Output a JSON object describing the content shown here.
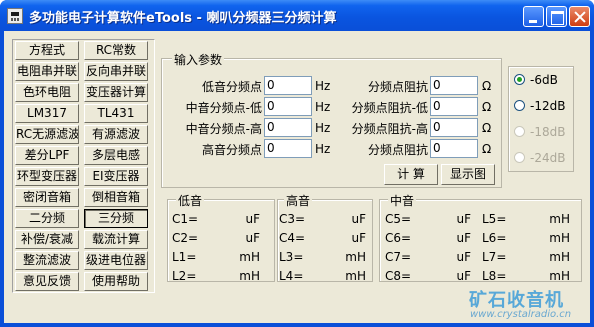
{
  "window": {
    "title": "多功能电子计算软件eTools - 喇叭分频器三分频计算"
  },
  "sidebar": {
    "buttons": [
      "方程式",
      "RC常数",
      "电阻串并联",
      "反向串并联",
      "色环电阻",
      "变压器计算",
      "LM317",
      "TL431",
      "RC无源滤波",
      "有源滤波",
      "差分LPF",
      "多层电感",
      "环型变压器",
      "EI变压器",
      "密闭音箱",
      "倒相音箱",
      "二分频",
      "三分频",
      "补偿/衰减",
      "载流计算",
      "整流滤波",
      "级进电位器",
      "意见反馈",
      "使用帮助"
    ],
    "active_index": 17
  },
  "input_group": {
    "label": "输入参数",
    "rows": [
      {
        "freq_label": "低音分频点",
        "freq_value": "0",
        "freq_unit": "Hz",
        "imp_label": "分频点阻抗",
        "imp_value": "0",
        "imp_unit": "Ω"
      },
      {
        "freq_label": "中音分频点-低",
        "freq_value": "0",
        "freq_unit": "Hz",
        "imp_label": "分频点阻抗-低",
        "imp_value": "0",
        "imp_unit": "Ω"
      },
      {
        "freq_label": "中音分频点-高",
        "freq_value": "0",
        "freq_unit": "Hz",
        "imp_label": "分频点阻抗-高",
        "imp_value": "0",
        "imp_unit": "Ω"
      },
      {
        "freq_label": "高音分频点",
        "freq_value": "0",
        "freq_unit": "Hz",
        "imp_label": "分频点阻抗",
        "imp_value": "0",
        "imp_unit": "Ω"
      }
    ],
    "calc_label": "计 算",
    "show_label": "显示图"
  },
  "slope": {
    "options": [
      {
        "label": "-6dB",
        "checked": true,
        "disabled": false
      },
      {
        "label": "-12dB",
        "checked": false,
        "disabled": false
      },
      {
        "label": "-18dB",
        "checked": false,
        "disabled": true
      },
      {
        "label": "-24dB",
        "checked": false,
        "disabled": true
      }
    ]
  },
  "results": {
    "bass": {
      "label": "低音",
      "rows": [
        {
          "name": "C1=",
          "unit": "uF"
        },
        {
          "name": "C2=",
          "unit": "uF"
        },
        {
          "name": "L1=",
          "unit": "mH"
        },
        {
          "name": "L2=",
          "unit": "mH"
        }
      ]
    },
    "treble": {
      "label": "高音",
      "rows": [
        {
          "name": "C3=",
          "unit": "uF"
        },
        {
          "name": "C4=",
          "unit": "uF"
        },
        {
          "name": "L3=",
          "unit": "mH"
        },
        {
          "name": "L4=",
          "unit": "mH"
        }
      ]
    },
    "mid": {
      "label": "中音",
      "left": [
        {
          "name": "C5=",
          "unit": "uF"
        },
        {
          "name": "C6=",
          "unit": "uF"
        },
        {
          "name": "C7=",
          "unit": "uF"
        },
        {
          "name": "C8=",
          "unit": "uF"
        }
      ],
      "right": [
        {
          "name": "L5=",
          "unit": "mH"
        },
        {
          "name": "L6=",
          "unit": "mH"
        },
        {
          "name": "L7=",
          "unit": "mH"
        },
        {
          "name": "L8=",
          "unit": "mH"
        }
      ]
    }
  },
  "watermark": {
    "cn": "矿石收音机",
    "url": "www.crystalradio.cn"
  }
}
